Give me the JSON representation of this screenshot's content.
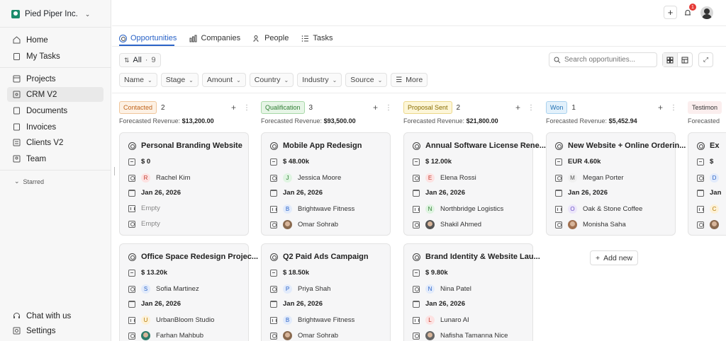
{
  "workspace": {
    "name": "Pied Piper Inc."
  },
  "sidebar": {
    "nav": [
      {
        "label": "Home",
        "icon": "home-icon"
      },
      {
        "label": "My Tasks",
        "icon": "clipboard-icon"
      },
      {
        "label": "Projects",
        "icon": "layout-icon"
      },
      {
        "label": "CRM V2",
        "icon": "crm-icon"
      },
      {
        "label": "Documents",
        "icon": "document-icon"
      },
      {
        "label": "Invoices",
        "icon": "invoice-icon"
      },
      {
        "label": "Clients V2",
        "icon": "clients-icon"
      },
      {
        "label": "Team",
        "icon": "team-icon"
      }
    ],
    "starred": "Starred",
    "bottom": [
      {
        "label": "Chat with us",
        "icon": "headset-icon"
      },
      {
        "label": "Settings",
        "icon": "settings-icon"
      }
    ]
  },
  "topbar": {
    "notifications_count": "1"
  },
  "tabs": [
    "Opportunities",
    "Companies",
    "People",
    "Tasks"
  ],
  "toolbar": {
    "all_label": "All",
    "all_count": "9",
    "search_placeholder": "Search opportunities...",
    "filters": [
      "Name",
      "Stage",
      "Amount",
      "Country",
      "Industry",
      "Source"
    ],
    "more_label": "More"
  },
  "columns": [
    {
      "stage": "Contacted",
      "count": "2",
      "forecast_label": "Forecasted Revenue:",
      "forecast_value": "$13,200.00",
      "color": "#c0631a",
      "bg": "#fdf1e4",
      "border": "#f0c69c",
      "cards": [
        {
          "title": "Personal Branding Website",
          "amount": "$ 0",
          "contact": "Rachel Kim",
          "contact_initial": "R",
          "date": "Jan 26, 2026",
          "company": "Empty",
          "owner": "Empty"
        },
        {
          "title": "Office Space Redesign Projec...",
          "amount": "$ 13.20k",
          "contact": "Sofia Martinez",
          "contact_initial": "S",
          "date": "Jan 26, 2026",
          "company": "UrbanBloom Studio",
          "company_initial": "U",
          "owner": "Farhan Mahbub"
        }
      ]
    },
    {
      "stage": "Qualification",
      "count": "3",
      "forecast_label": "Forecasted Revenue:",
      "forecast_value": "$93,500.00",
      "color": "#2e7d32",
      "bg": "#e6f5e6",
      "border": "#a7d8a8",
      "cards": [
        {
          "title": "Mobile App Redesign",
          "amount": "$ 48.00k",
          "contact": "Jessica Moore",
          "contact_initial": "J",
          "date": "Jan 26, 2026",
          "company": "Brightwave Fitness",
          "company_initial": "B",
          "owner": "Omar Sohrab"
        },
        {
          "title": "Q2 Paid Ads Campaign",
          "amount": "$ 18.50k",
          "contact": "Priya Shah",
          "contact_initial": "P",
          "date": "Jan 26, 2026",
          "company": "Brightwave Fitness",
          "company_initial": "B",
          "owner": "Omar Sohrab"
        }
      ]
    },
    {
      "stage": "Proposal Sent",
      "count": "2",
      "forecast_label": "Forecasted Revenue:",
      "forecast_value": "$21,800.00",
      "color": "#8a6d00",
      "bg": "#fdf6d8",
      "border": "#ecd88a",
      "cards": [
        {
          "title": "Annual Software License Rene...",
          "amount": "$ 12.00k",
          "contact": "Elena Rossi",
          "contact_initial": "E",
          "date": "Jan 26, 2026",
          "company": "Northbridge Logistics",
          "company_initial": "N",
          "owner": "Shakil Ahmed"
        },
        {
          "title": "Brand Identity & Website Lau...",
          "amount": "$ 9.80k",
          "contact": "Nina Patel",
          "contact_initial": "N",
          "date": "Jan 26, 2026",
          "company": "Lunaro AI",
          "company_initial": "L",
          "owner": "Nafisha Tamanna Nice"
        }
      ]
    },
    {
      "stage": "Won",
      "count": "1",
      "forecast_label": "Forecasted Revenue:",
      "forecast_value": "$5,452.94",
      "color": "#1f6fb2",
      "bg": "#e3f1fb",
      "border": "#a9d2ef",
      "cards": [
        {
          "title": "New Website + Online Orderin...",
          "amount": "EUR 4.60k",
          "contact": "Megan Porter",
          "contact_initial": "M",
          "date": "Jan 26, 2026",
          "company": "Oak & Stone Coffee",
          "company_initial": "O",
          "owner": "Monisha Saha"
        }
      ],
      "add_new": "Add new"
    },
    {
      "stage": "Testimon",
      "forecast_label": "Forecasted",
      "cards": [
        {
          "title": "Ex",
          "amount": "$",
          "contact_initial": "D",
          "date": "Jan",
          "company_initial": "C"
        }
      ]
    }
  ]
}
